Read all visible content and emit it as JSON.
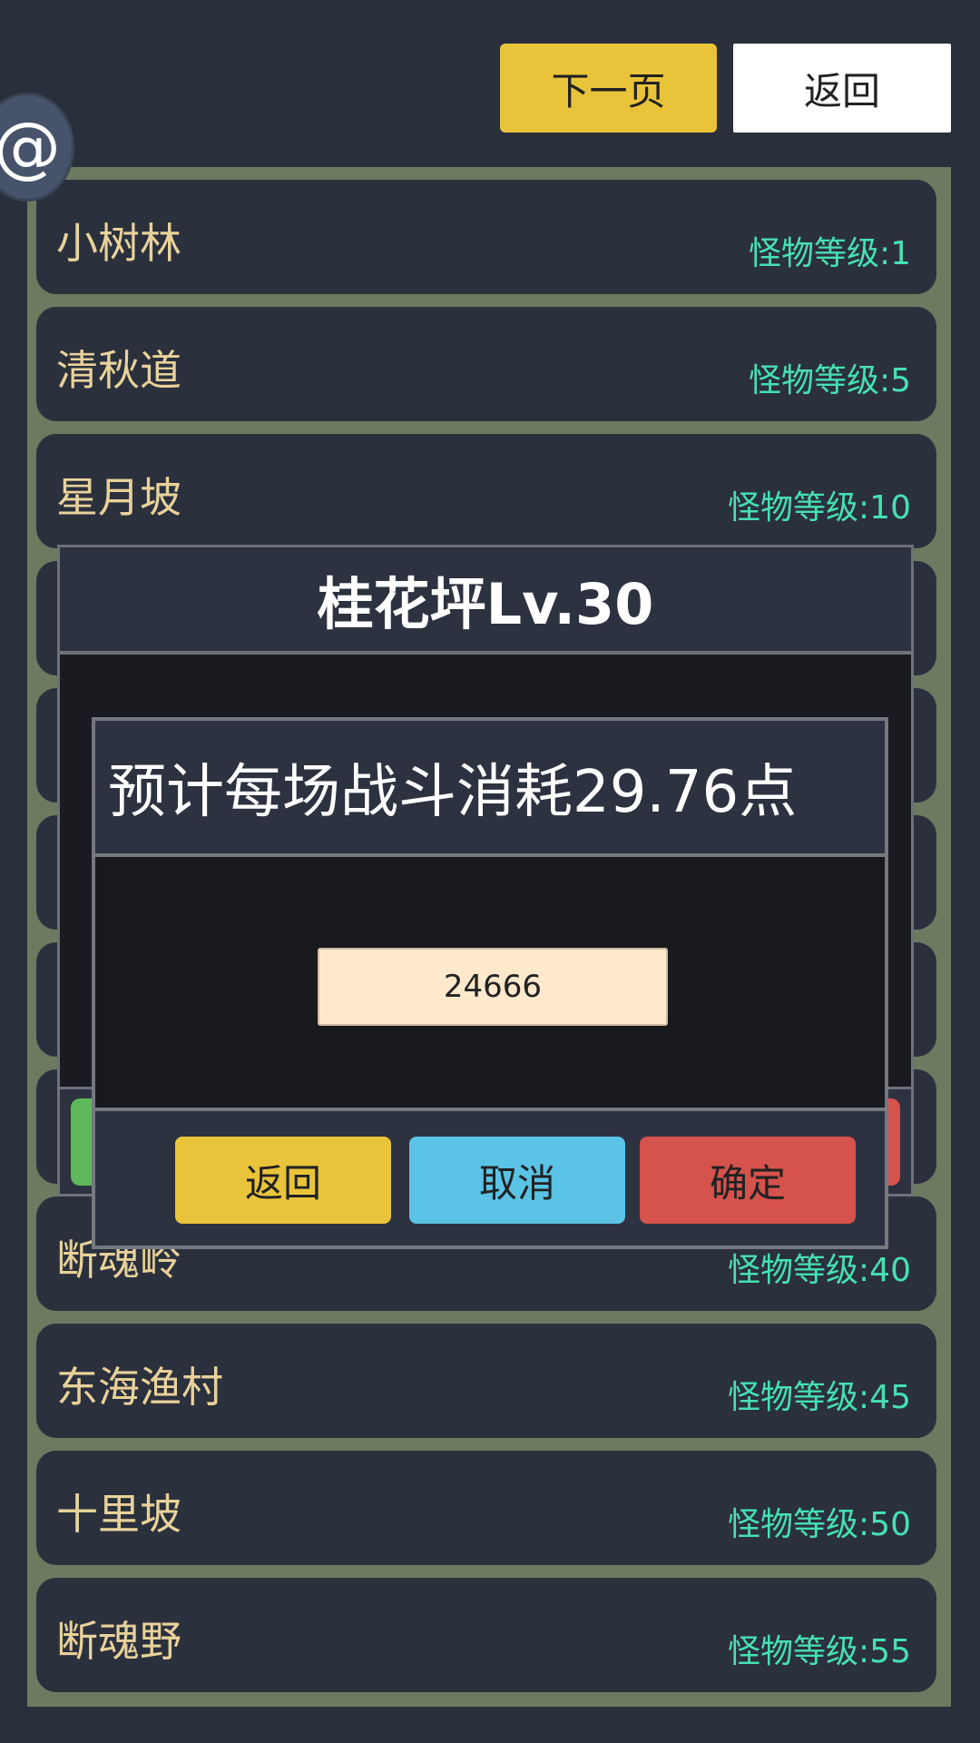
{
  "header": {
    "next_page_label": "下一页",
    "back_label": "返回",
    "at_symbol": "@"
  },
  "areas": [
    {
      "name": "小树林",
      "level": "怪物等级:1"
    },
    {
      "name": "清秋道",
      "level": "怪物等级:5"
    },
    {
      "name": "星月坡",
      "level": "怪物等级:10"
    },
    {
      "name": "",
      "level": ""
    },
    {
      "name": "",
      "level": ""
    },
    {
      "name": "",
      "level": ""
    },
    {
      "name": "",
      "level": ""
    },
    {
      "name": "",
      "level": ""
    },
    {
      "name": "断魂岭",
      "level": "怪物等级:40"
    },
    {
      "name": "东海渔村",
      "level": "怪物等级:45"
    },
    {
      "name": "十里坡",
      "level": "怪物等级:50"
    },
    {
      "name": "断魂野",
      "level": "怪物等级:55"
    }
  ],
  "area_dialog": {
    "title": "桂花坪Lv.30"
  },
  "confirm_dialog": {
    "title": "预计每场战斗消耗29.76点",
    "input_value": "24666",
    "return_label": "返回",
    "cancel_label": "取消",
    "confirm_label": "确定"
  }
}
